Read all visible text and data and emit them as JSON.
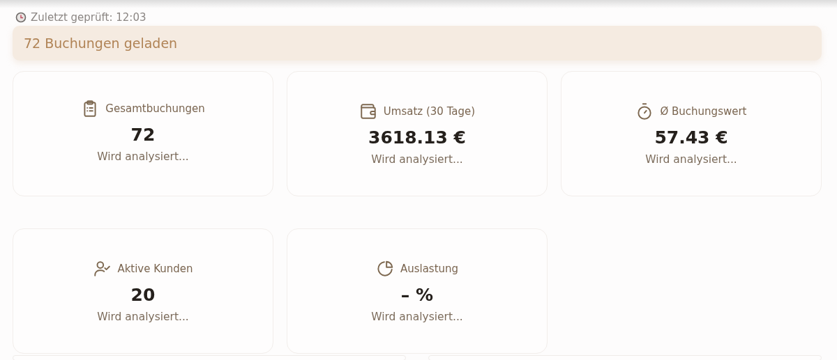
{
  "last_checked": "Zuletzt geprüft: 12:03",
  "banner": "72 Buchungen geladen",
  "stats": [
    {
      "label": "Gesamtbuchungen",
      "value": "72",
      "note": "Wird analysiert..."
    },
    {
      "label": "Umsatz (30 Tage)",
      "value": "3618.13 €",
      "note": "Wird analysiert..."
    },
    {
      "label": "Ø Buchungswert",
      "value": "57.43 €",
      "note": "Wird analysiert..."
    },
    {
      "label": "Aktive Kunden",
      "value": "20",
      "note": "Wird analysiert..."
    },
    {
      "label": "Auslastung",
      "value": "– %",
      "note": "Wird analysiert..."
    }
  ]
}
